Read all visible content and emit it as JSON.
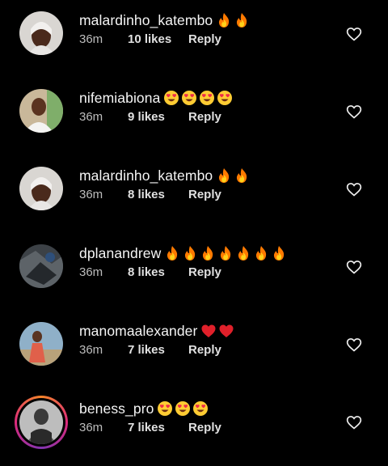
{
  "comments": [
    {
      "username": "malardinho_katembo",
      "emojis": [
        "fire",
        "fire"
      ],
      "time": "36m",
      "likes": "10 likes",
      "reply": "Reply"
    },
    {
      "username": "nifemiabiona",
      "emojis": [
        "heart-eyes",
        "heart-eyes",
        "heart-eyes",
        "heart-eyes"
      ],
      "time": "36m",
      "likes": "9 likes",
      "reply": "Reply"
    },
    {
      "username": "malardinho_katembo",
      "emojis": [
        "fire",
        "fire"
      ],
      "time": "36m",
      "likes": "8 likes",
      "reply": "Reply"
    },
    {
      "username": "dplanandrew",
      "emojis": [
        "fire",
        "fire",
        "fire",
        "fire",
        "fire",
        "fire",
        "fire"
      ],
      "time": "36m",
      "likes": "8 likes",
      "reply": "Reply"
    },
    {
      "username": "manomaalexander",
      "emojis": [
        "red-heart",
        "red-heart"
      ],
      "time": "36m",
      "likes": "7 likes",
      "reply": "Reply"
    },
    {
      "username": "beness_pro",
      "emojis": [
        "heart-eyes",
        "heart-eyes",
        "heart-eyes"
      ],
      "time": "36m",
      "likes": "7 likes",
      "reply": "Reply"
    }
  ],
  "colors": {
    "background": "#000000",
    "text": "#f5f5f5",
    "meta": "#bdbdbd",
    "story_ring": "#dd2a7b"
  }
}
